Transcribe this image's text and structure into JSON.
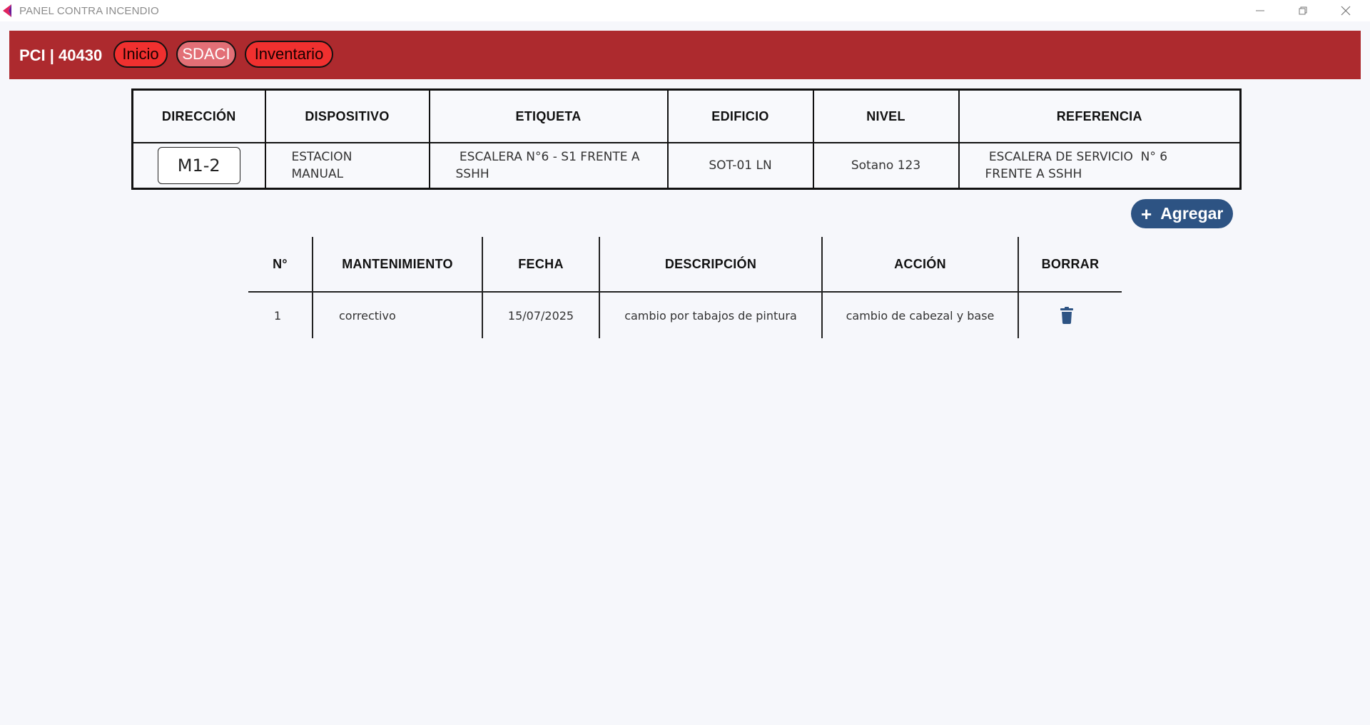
{
  "window": {
    "title": "PANEL CONTRA INCENDIO",
    "controls": [
      "minimize-icon",
      "restore-icon",
      "close-icon"
    ]
  },
  "colors": {
    "navbar": "#ad2a2e",
    "pill": "#f0302f",
    "pill_active": "#e26f76",
    "button": "#2d5383"
  },
  "navbar": {
    "brand": "PCI | 40430",
    "items": [
      {
        "label": "Inicio",
        "active": false
      },
      {
        "label": "SDACI",
        "active": true
      },
      {
        "label": "Inventario",
        "active": false
      }
    ]
  },
  "device": {
    "headers": [
      "DIRECCIÓN",
      "DISPOSITIVO",
      "ETIQUETA",
      "EDIFICIO",
      "NIVEL",
      "REFERENCIA"
    ],
    "row": {
      "direccion": "M1-2",
      "dispositivo": "ESTACION MANUAL",
      "etiqueta": " ESCALERA N°6 - S1 FRENTE A SSHH",
      "edificio": "SOT-01 LN",
      "nivel": "Sotano 123",
      "referencia": " ESCALERA DE SERVICIO  N° 6 FRENTE A SSHH"
    }
  },
  "add_button": {
    "label": "Agregar",
    "icon": "plus-icon"
  },
  "maintenance": {
    "headers": [
      "N°",
      "MANTENIMIENTO",
      "FECHA",
      "DESCRIPCIÓN",
      "ACCIÓN",
      "BORRAR"
    ],
    "rows": [
      {
        "n": "1",
        "mantenimiento": "correctivo",
        "fecha": "15/07/2025",
        "descripcion": "cambio por tabajos de pintura",
        "accion": "cambio de cabezal y base",
        "delete_icon": "trash-icon"
      }
    ]
  }
}
